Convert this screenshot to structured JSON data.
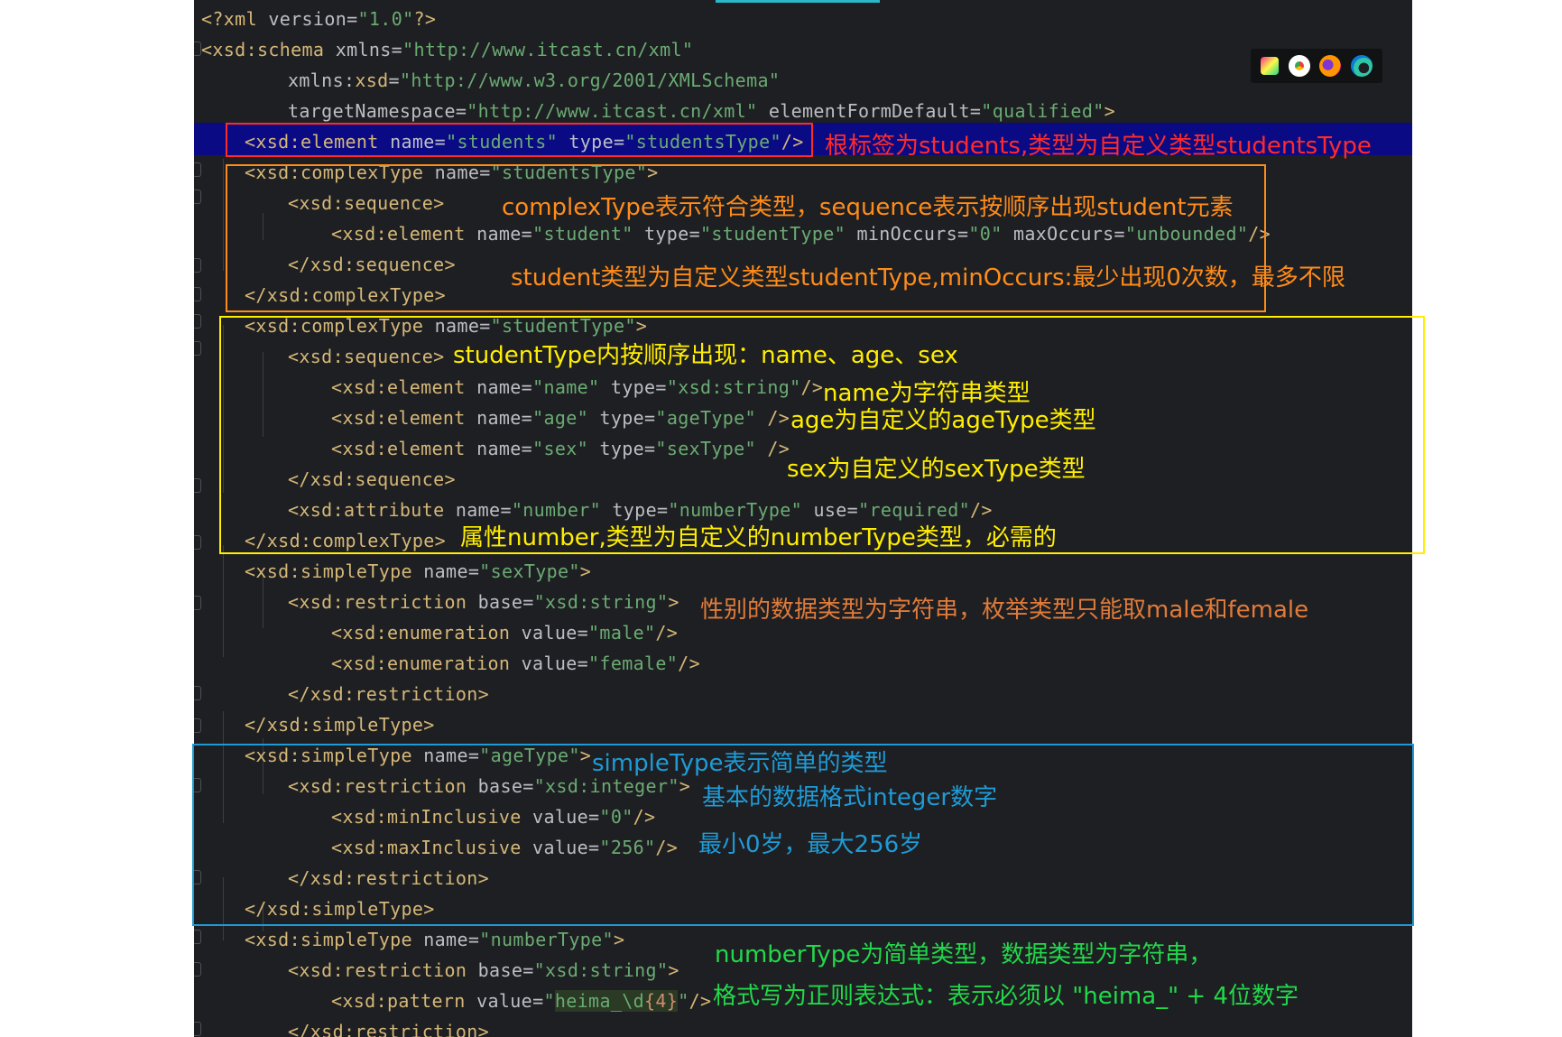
{
  "code_lines": [
    {
      "id": "l1",
      "parts": [
        [
          "pi",
          "<?xml "
        ],
        [
          "attr",
          "version"
        ],
        [
          "eq",
          "="
        ],
        [
          "val",
          "\"1.0\""
        ],
        [
          "pi",
          "?>"
        ]
      ]
    },
    {
      "id": "l2",
      "parts": [
        [
          "tag",
          "<xsd:schema "
        ],
        [
          "attr",
          "xmlns"
        ],
        [
          "eq",
          "="
        ],
        [
          "val",
          "\"http://www.itcast.cn/xml\""
        ]
      ]
    },
    {
      "id": "l3",
      "parts": [
        [
          "attr",
          "xmlns:"
        ],
        [
          "tag",
          "xsd"
        ],
        [
          "eq",
          "="
        ],
        [
          "val",
          "\"http://www.w3.org/2001/XMLSchema\""
        ]
      ]
    },
    {
      "id": "l4",
      "parts": [
        [
          "attr",
          "targetNamespace"
        ],
        [
          "eq",
          "="
        ],
        [
          "val",
          "\"http://www.itcast.cn/xml\" "
        ],
        [
          "attr",
          "elementFormDefault"
        ],
        [
          "eq",
          "="
        ],
        [
          "val",
          "\"qualified\""
        ],
        [
          "tag",
          ">"
        ]
      ]
    },
    {
      "id": "l5",
      "parts": [
        [
          "tag",
          "<xsd:element "
        ],
        [
          "attr",
          "name"
        ],
        [
          "eq",
          "="
        ],
        [
          "val",
          "\"students\" "
        ],
        [
          "attr",
          "type"
        ],
        [
          "eq",
          "="
        ],
        [
          "val",
          "\"studentsType\""
        ],
        [
          "tag",
          "/>"
        ]
      ]
    },
    {
      "id": "l6",
      "parts": [
        [
          "tag",
          "<xsd:complexType "
        ],
        [
          "attr",
          "name"
        ],
        [
          "eq",
          "="
        ],
        [
          "val",
          "\"studentsType\""
        ],
        [
          "tag",
          ">"
        ]
      ]
    },
    {
      "id": "l7",
      "parts": [
        [
          "tag",
          "<xsd:sequence>"
        ]
      ]
    },
    {
      "id": "l8",
      "parts": [
        [
          "tag",
          "<xsd:element "
        ],
        [
          "attr",
          "name"
        ],
        [
          "eq",
          "="
        ],
        [
          "val",
          "\"student\" "
        ],
        [
          "attr",
          "type"
        ],
        [
          "eq",
          "="
        ],
        [
          "val",
          "\"studentType\" "
        ],
        [
          "attr",
          "minOccurs"
        ],
        [
          "eq",
          "="
        ],
        [
          "val",
          "\"0\" "
        ],
        [
          "attr",
          "maxOccurs"
        ],
        [
          "eq",
          "="
        ],
        [
          "val",
          "\"unbounded\""
        ],
        [
          "tag",
          "/>"
        ]
      ]
    },
    {
      "id": "l9",
      "parts": [
        [
          "tag",
          "</xsd:sequence>"
        ]
      ]
    },
    {
      "id": "l10",
      "parts": [
        [
          "tag",
          "</xsd:complexType>"
        ]
      ]
    },
    {
      "id": "l11",
      "parts": [
        [
          "tag",
          "<xsd:complexType "
        ],
        [
          "attr",
          "name"
        ],
        [
          "eq",
          "="
        ],
        [
          "val",
          "\"studentType\""
        ],
        [
          "tag",
          ">"
        ]
      ]
    },
    {
      "id": "l12",
      "parts": [
        [
          "tag",
          "<xsd:sequence>"
        ]
      ]
    },
    {
      "id": "l13",
      "parts": [
        [
          "tag",
          "<xsd:element "
        ],
        [
          "attr",
          "name"
        ],
        [
          "eq",
          "="
        ],
        [
          "val",
          "\"name\" "
        ],
        [
          "attr",
          "type"
        ],
        [
          "eq",
          "="
        ],
        [
          "val",
          "\"xsd:string\""
        ],
        [
          "tag",
          "/>"
        ]
      ]
    },
    {
      "id": "l14",
      "parts": [
        [
          "tag",
          "<xsd:element "
        ],
        [
          "attr",
          "name"
        ],
        [
          "eq",
          "="
        ],
        [
          "val",
          "\"age\" "
        ],
        [
          "attr",
          "type"
        ],
        [
          "eq",
          "="
        ],
        [
          "val",
          "\"ageType\" "
        ],
        [
          "tag",
          "/>"
        ]
      ]
    },
    {
      "id": "l15",
      "parts": [
        [
          "tag",
          "<xsd:element "
        ],
        [
          "attr",
          "name"
        ],
        [
          "eq",
          "="
        ],
        [
          "val",
          "\"sex\" "
        ],
        [
          "attr",
          "type"
        ],
        [
          "eq",
          "="
        ],
        [
          "val",
          "\"sexType\" "
        ],
        [
          "tag",
          "/>"
        ]
      ]
    },
    {
      "id": "l16",
      "parts": [
        [
          "tag",
          "</xsd:sequence>"
        ]
      ]
    },
    {
      "id": "l17",
      "parts": [
        [
          "tag",
          "<xsd:attribute "
        ],
        [
          "attr",
          "name"
        ],
        [
          "eq",
          "="
        ],
        [
          "val",
          "\"number\" "
        ],
        [
          "attr",
          "type"
        ],
        [
          "eq",
          "="
        ],
        [
          "val",
          "\"numberType\" "
        ],
        [
          "attr",
          "use"
        ],
        [
          "eq",
          "="
        ],
        [
          "val",
          "\"required\""
        ],
        [
          "tag",
          "/>"
        ]
      ]
    },
    {
      "id": "l18",
      "parts": [
        [
          "tag",
          "</xsd:complexType>"
        ]
      ]
    },
    {
      "id": "l19",
      "parts": [
        [
          "tag",
          "<xsd:simpleType "
        ],
        [
          "attr",
          "name"
        ],
        [
          "eq",
          "="
        ],
        [
          "val",
          "\"sexType\""
        ],
        [
          "tag",
          ">"
        ]
      ]
    },
    {
      "id": "l20",
      "parts": [
        [
          "tag",
          "<xsd:restriction "
        ],
        [
          "attr",
          "base"
        ],
        [
          "eq",
          "="
        ],
        [
          "val",
          "\"xsd:string\""
        ],
        [
          "tag",
          ">"
        ]
      ]
    },
    {
      "id": "l21",
      "parts": [
        [
          "tag",
          "<xsd:enumeration "
        ],
        [
          "attr",
          "value"
        ],
        [
          "eq",
          "="
        ],
        [
          "val",
          "\"male\""
        ],
        [
          "tag",
          "/>"
        ]
      ]
    },
    {
      "id": "l22",
      "parts": [
        [
          "tag",
          "<xsd:enumeration "
        ],
        [
          "attr",
          "value"
        ],
        [
          "eq",
          "="
        ],
        [
          "val",
          "\"female\""
        ],
        [
          "tag",
          "/>"
        ]
      ]
    },
    {
      "id": "l23",
      "parts": [
        [
          "tag",
          "</xsd:restriction>"
        ]
      ]
    },
    {
      "id": "l24",
      "parts": [
        [
          "tag",
          "</xsd:simpleType>"
        ]
      ]
    },
    {
      "id": "l25",
      "parts": [
        [
          "tag",
          "<xsd:simpleType "
        ],
        [
          "attr",
          "name"
        ],
        [
          "eq",
          "="
        ],
        [
          "val",
          "\"ageType\""
        ],
        [
          "tag",
          ">"
        ]
      ]
    },
    {
      "id": "l26",
      "parts": [
        [
          "tag",
          "<xsd:restriction "
        ],
        [
          "attr",
          "base"
        ],
        [
          "eq",
          "="
        ],
        [
          "val",
          "\"xsd:integer\""
        ],
        [
          "tag",
          ">"
        ]
      ]
    },
    {
      "id": "l27",
      "parts": [
        [
          "tag",
          "<xsd:minInclusive "
        ],
        [
          "attr",
          "value"
        ],
        [
          "eq",
          "="
        ],
        [
          "val",
          "\"0\""
        ],
        [
          "tag",
          "/>"
        ]
      ]
    },
    {
      "id": "l28",
      "parts": [
        [
          "tag",
          "<xsd:maxInclusive "
        ],
        [
          "attr",
          "value"
        ],
        [
          "eq",
          "="
        ],
        [
          "val",
          "\"256\""
        ],
        [
          "tag",
          "/>"
        ]
      ]
    },
    {
      "id": "l29",
      "parts": [
        [
          "tag",
          "</xsd:restriction>"
        ]
      ]
    },
    {
      "id": "l30",
      "parts": [
        [
          "tag",
          "</xsd:simpleType>"
        ]
      ]
    },
    {
      "id": "l31",
      "parts": [
        [
          "tag",
          "<xsd:simpleType "
        ],
        [
          "attr",
          "name"
        ],
        [
          "eq",
          "="
        ],
        [
          "val",
          "\"numberType\""
        ],
        [
          "tag",
          ">"
        ]
      ]
    },
    {
      "id": "l32",
      "parts": [
        [
          "tag",
          "<xsd:restriction "
        ],
        [
          "attr",
          "base"
        ],
        [
          "eq",
          "="
        ],
        [
          "val",
          "\"xsd:string\""
        ],
        [
          "tag",
          ">"
        ]
      ]
    },
    {
      "id": "l33",
      "parts": [
        [
          "tag",
          "<xsd:pattern "
        ],
        [
          "attr",
          "value"
        ],
        [
          "eq",
          "="
        ],
        [
          "val",
          "\""
        ],
        [
          "rx",
          "heima_\\d"
        ],
        [
          "rxk",
          "{4}"
        ],
        [
          "val",
          "\""
        ],
        [
          "tag",
          "/>"
        ]
      ]
    },
    {
      "id": "l34",
      "parts": [
        [
          "tag",
          "</xsd:restriction>"
        ]
      ]
    }
  ],
  "annotations": {
    "root": "根标签为students,类型为自定义类型studentsType",
    "complex_seq": "complexType表示符合类型，sequence表示按顺序出现student元素",
    "student_type": "student类型为自定义类型studentType,minOccurs:最少出现0次数，最多不限",
    "student_type_seq": "studentType内按顺序出现：name、age、sex",
    "name_note": "name为字符串类型",
    "age_note": "age为自定义的ageType类型",
    "sex_note": "sex为自定义的sexType类型",
    "number_attr": "属性number,类型为自定义的numberType类型，必需的",
    "sex_enum": "性别的数据类型为字符串，枚举类型只能取male和female",
    "simple_type": "simpleType表示简单的类型",
    "integer_base": "基本的数据格式integer数字",
    "age_range": "最小0岁，最大256岁",
    "number_type_1": "numberType为简单类型，数据类型为字符串，",
    "number_type_2": "格式写为正则表达式：表示必须以 \"heima_\" + 4位数字"
  },
  "colors": {
    "editor_bg": "#1e1f22",
    "highlight_bg": "#0a0a84",
    "red": "#ff2b2b",
    "orange": "#ff8c1a",
    "yellow": "#ffee00",
    "blue": "#1e9bd7",
    "green": "#22d84a",
    "beige": "#e07b3a"
  },
  "browser_icons": [
    "jetbrains-icon",
    "chrome-icon",
    "firefox-icon",
    "edge-icon"
  ]
}
